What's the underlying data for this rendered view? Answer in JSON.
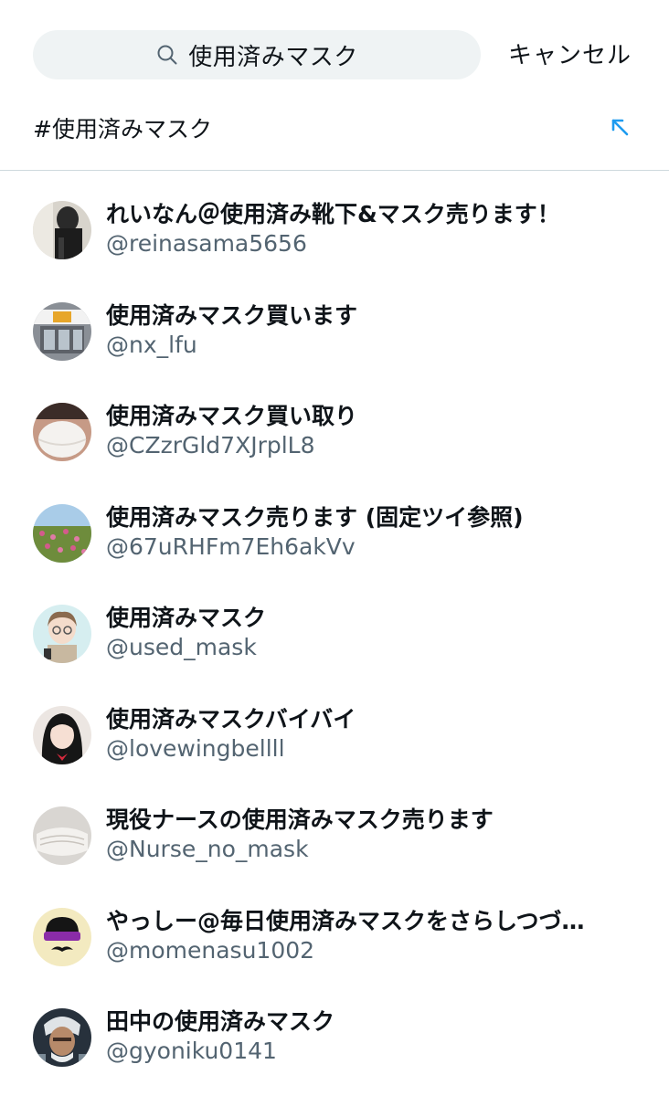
{
  "search": {
    "query": "使用済みマスク",
    "cancel_label": "キャンセル"
  },
  "hashtag": {
    "text": "#使用済みマスク"
  },
  "users": [
    {
      "name": "れいなん＠使用済み靴下&マスク売ります！",
      "handle": "@reinasama5656",
      "avatar": "dark-figure"
    },
    {
      "name": "使用済みマスク買います",
      "handle": "@nx_lfu",
      "avatar": "shopfront"
    },
    {
      "name": "使用済みマスク買い取り",
      "handle": "@CZzrGld7XJrplL8",
      "avatar": "masked-face"
    },
    {
      "name": "使用済みマスク売ります (固定ツイ参照)",
      "handle": "@67uRHFm7Eh6akVv",
      "avatar": "flower-field"
    },
    {
      "name": "使用済みマスク",
      "handle": "@used_mask",
      "avatar": "anime-glasses"
    },
    {
      "name": "使用済みマスクバイバイ",
      "handle": "@lovewingbellll",
      "avatar": "dark-hair-girl"
    },
    {
      "name": "現役ナースの使用済みマスク売ります",
      "handle": "@Nurse_no_mask",
      "avatar": "white-mask"
    },
    {
      "name": "やっしー@毎日使用済みマスクをさらしつづ…",
      "handle": "@momenasu1002",
      "avatar": "sunglasses-cartoon"
    },
    {
      "name": "田中の使用済みマスク",
      "handle": "@gyoniku0141",
      "avatar": "armored-character"
    }
  ],
  "colors": {
    "accent": "#1d9bf0",
    "secondary_text": "#536471",
    "search_bg": "#eff3f4"
  }
}
